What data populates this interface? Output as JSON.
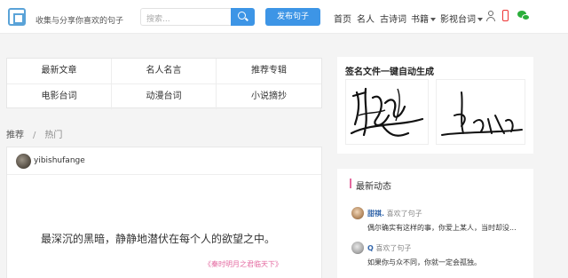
{
  "header": {
    "slogan": "收集与分享你喜欢的句子",
    "search_placeholder": "搜索...",
    "publish_label": "发布句子",
    "nav": [
      {
        "label": "首页"
      },
      {
        "label": "名人"
      },
      {
        "label": "古诗词"
      },
      {
        "label": "书籍",
        "dropdown": true
      },
      {
        "label": "影视台词",
        "dropdown": true
      }
    ],
    "icons": [
      "user-icon",
      "phone-icon",
      "wechat-icon"
    ],
    "accent": "#3d95e6"
  },
  "categories": [
    {
      "label": "最新文章"
    },
    {
      "label": "名人名言"
    },
    {
      "label": "推荐专辑"
    },
    {
      "label": "电影台词"
    },
    {
      "label": "动漫台词"
    },
    {
      "label": "小说摘抄"
    }
  ],
  "breadcrumb": {
    "root": "推荐",
    "separator": "/",
    "current": "热门"
  },
  "post": {
    "author": "yibishufange",
    "quote": "最深沉的黑暗，静静地潜伏在每个人的欲望之中。",
    "source": "《秦时明月之君临天下》",
    "source_color": "#e46aa0"
  },
  "signature": {
    "title": "签名文件一键自动生成"
  },
  "activity": {
    "title": "最新动态",
    "accent": "#e46aa0",
    "items": [
      {
        "name": "甜祺.",
        "action": "喜欢了句子",
        "text": "偶尔确实有这样的事，你爱上某人，当时却没..."
      },
      {
        "name": "Q",
        "action": "喜欢了句子",
        "text": "如果你与众不同，你就一定会孤独。"
      }
    ]
  }
}
